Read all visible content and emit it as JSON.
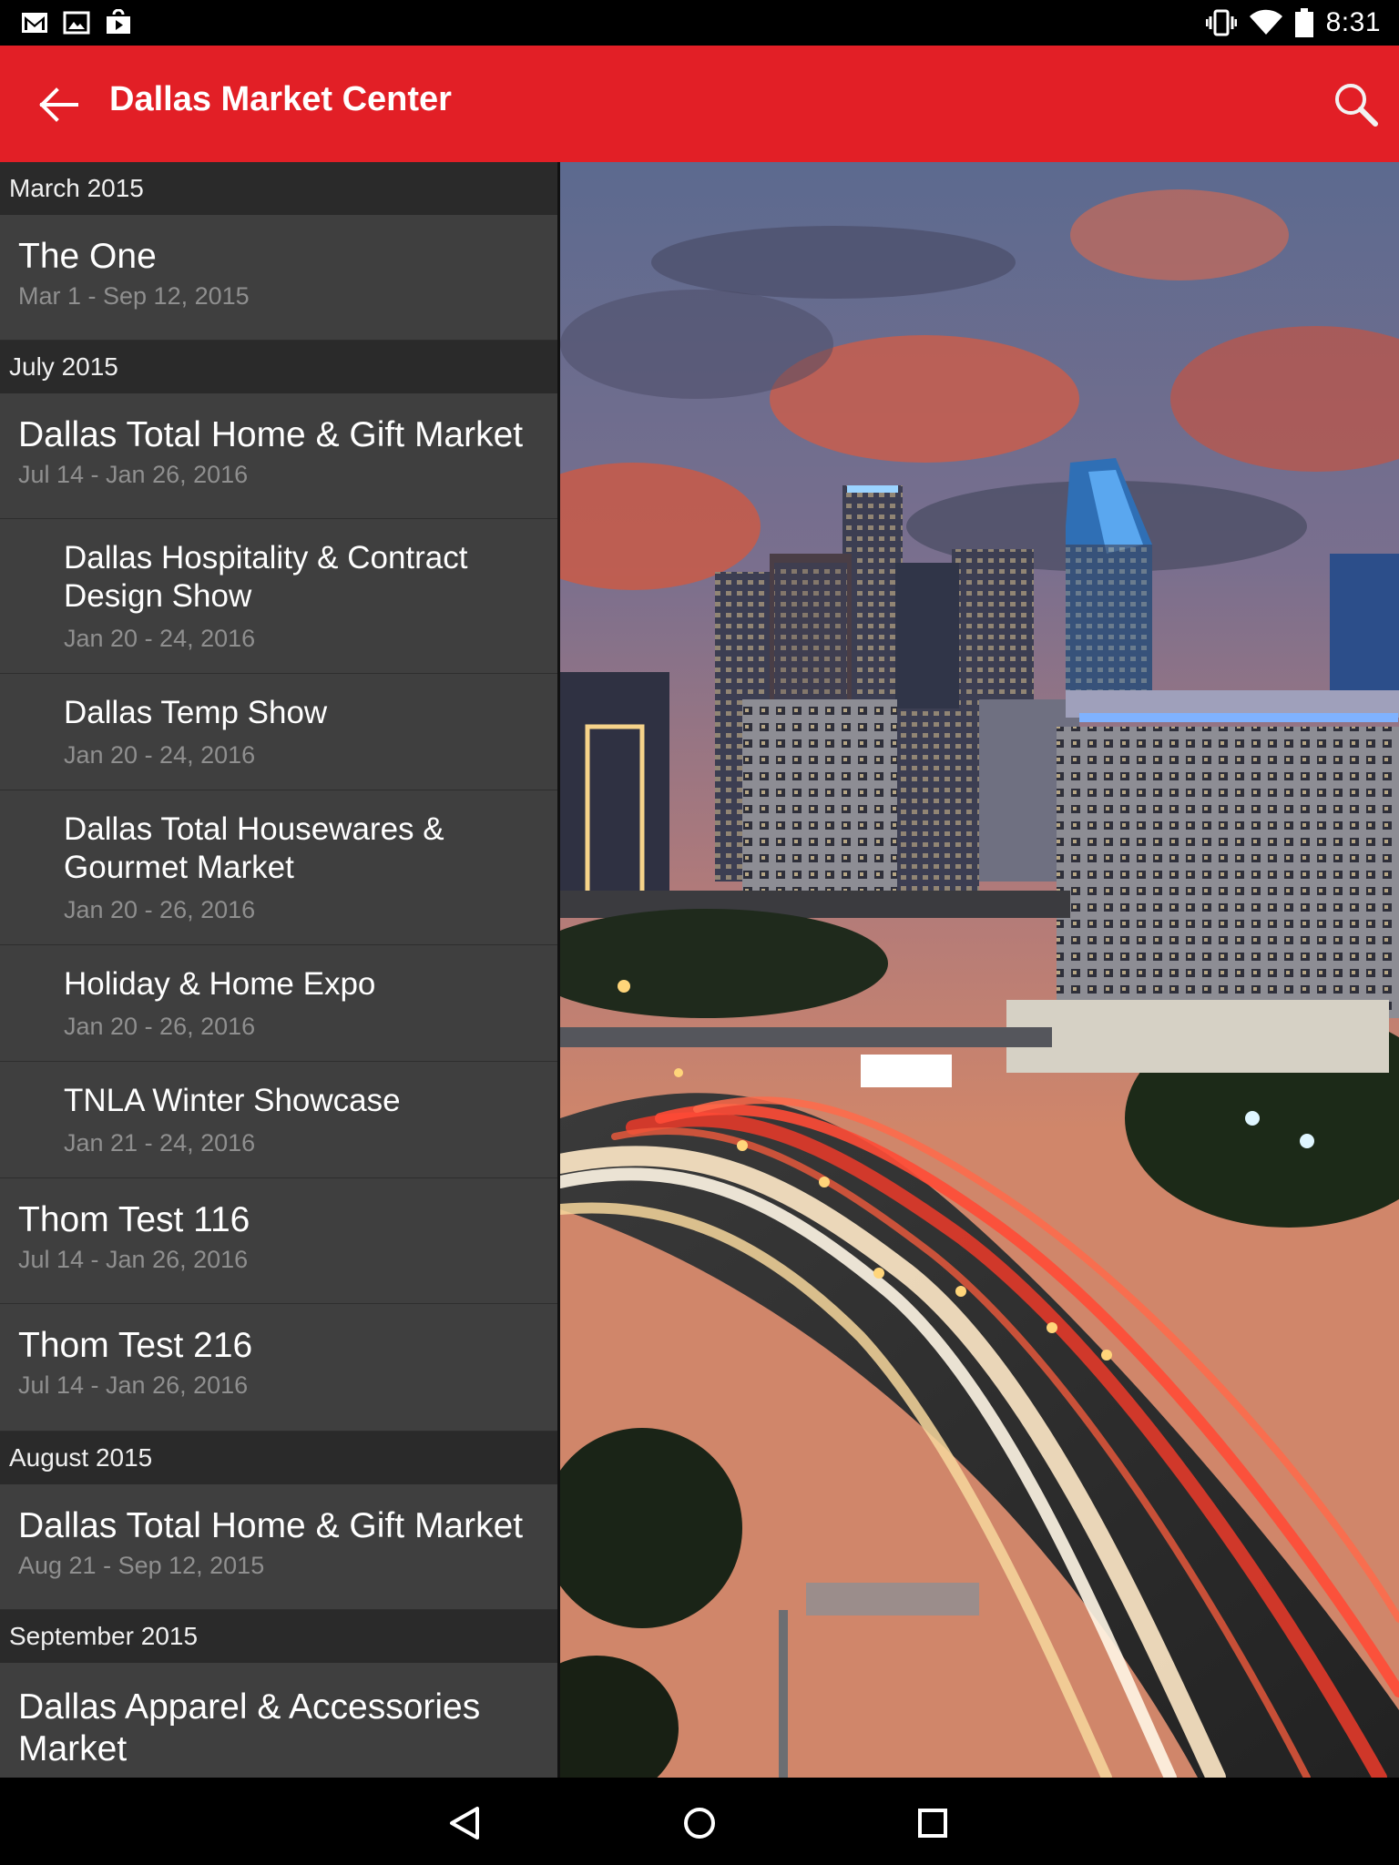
{
  "status_bar": {
    "time": "8:31",
    "left_icons": [
      "gmail-icon",
      "gallery-icon",
      "play-store-icon"
    ],
    "right_icons": [
      "vibrate-icon",
      "wifi-icon",
      "battery-icon"
    ]
  },
  "app_bar": {
    "title": "Dallas Market Center",
    "color": "#e21f26",
    "back_icon": "arrow-back-icon",
    "search_icon": "search-icon"
  },
  "list": {
    "sections": [
      {
        "header": "March 2015",
        "items": [
          {
            "name": "The One",
            "dates": "Mar 1 - Sep 12, 2015",
            "level": "top"
          }
        ]
      },
      {
        "header": "July 2015",
        "items": [
          {
            "name": "Dallas Total Home & Gift Market",
            "dates": "Jul 14 - Jan 26, 2016",
            "level": "top"
          },
          {
            "name": "Dallas Hospitality & Contract Design Show",
            "dates": "Jan 20 - 24, 2016",
            "level": "sub"
          },
          {
            "name": "Dallas Temp Show",
            "dates": "Jan 20 - 24, 2016",
            "level": "sub"
          },
          {
            "name": "Dallas Total Housewares & Gourmet Market",
            "dates": "Jan 20 - 26, 2016",
            "level": "sub"
          },
          {
            "name": "Holiday & Home Expo",
            "dates": "Jan 20 - 26, 2016",
            "level": "sub"
          },
          {
            "name": "TNLA Winter Showcase",
            "dates": "Jan 21 - 24, 2016",
            "level": "sub"
          },
          {
            "name": "Thom Test 116",
            "dates": "Jul 14 - Jan 26, 2016",
            "level": "top"
          },
          {
            "name": "Thom Test 216",
            "dates": "Jul 14 - Jan 26, 2016",
            "level": "top"
          }
        ]
      },
      {
        "header": "August 2015",
        "items": [
          {
            "name": "Dallas Total Home & Gift Market",
            "dates": "Aug 21 - Sep 12, 2015",
            "level": "top"
          }
        ]
      },
      {
        "header": "September 2015",
        "items": [
          {
            "name": "Dallas Apparel & Accessories Market",
            "dates": "",
            "level": "top"
          }
        ]
      }
    ]
  },
  "hero_image": {
    "subject": "dallas-skyline-night-highway-photo"
  },
  "nav_bar": {
    "buttons": [
      "back-nav-icon",
      "home-nav-icon",
      "recents-nav-icon"
    ]
  }
}
